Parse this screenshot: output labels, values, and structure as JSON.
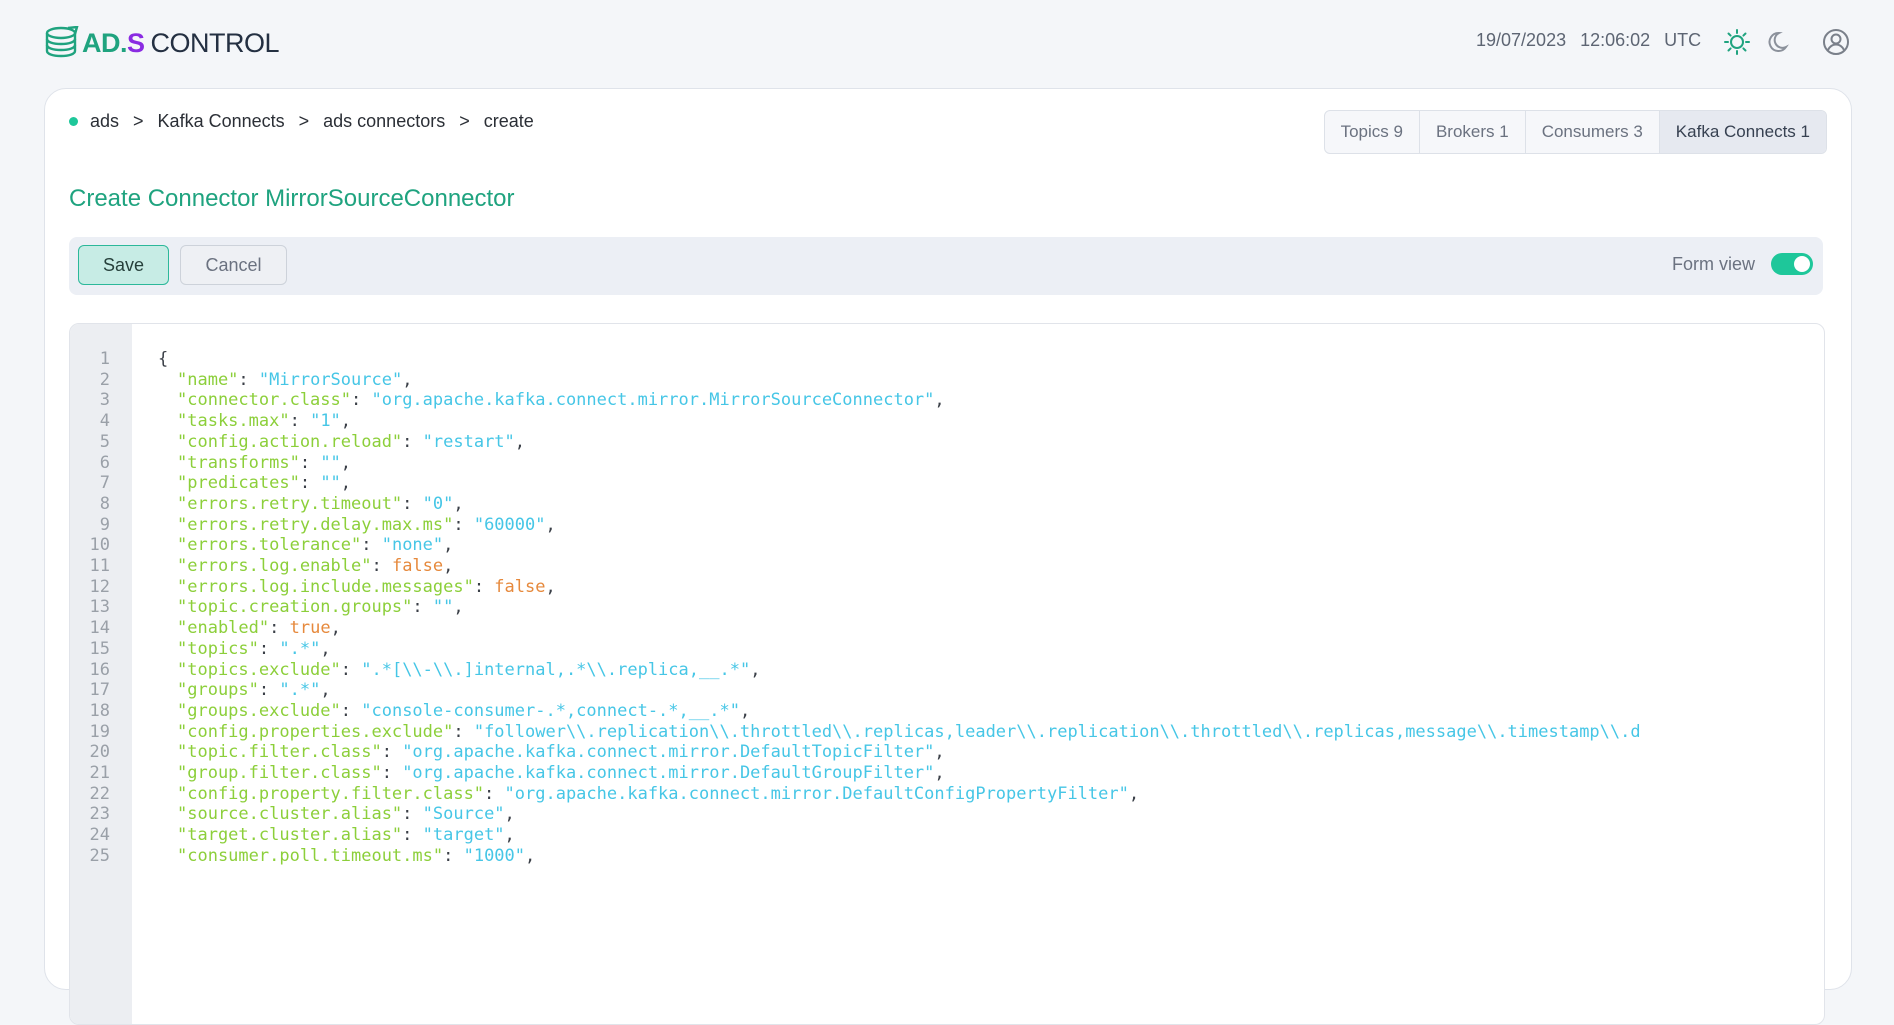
{
  "header": {
    "logo_text": "AD.S CONTROL",
    "date": "19/07/2023",
    "time": "12:06:02",
    "timezone": "UTC",
    "icons": [
      "light-theme-icon",
      "dark-theme-icon",
      "user-account-icon"
    ]
  },
  "breadcrumb": [
    {
      "label": "ads"
    },
    {
      "label": "Kafka Connects"
    },
    {
      "label": "ads connectors"
    },
    {
      "label": "create"
    }
  ],
  "tabs": [
    {
      "label": "Topics 9"
    },
    {
      "label": "Brokers 1"
    },
    {
      "label": "Consumers 3"
    },
    {
      "label": "Kafka Connects 1",
      "active": true
    }
  ],
  "page_title": "Create Connector MirrorSourceConnector",
  "toolbar": {
    "save_label": "Save",
    "cancel_label": "Cancel",
    "form_view_label": "Form view",
    "form_view_enabled": true
  },
  "colors": {
    "accent": "#1fa37f",
    "toggle_on": "#1ec79a",
    "json_key": "#8ccf3a",
    "json_string": "#46c6e6",
    "json_boolean": "#e6893c"
  },
  "editor": {
    "open_brace": "{",
    "entries": [
      {
        "key": "\"name\"",
        "value": "\"MirrorSource\"",
        "type": "string"
      },
      {
        "key": "\"connector.class\"",
        "value": "\"org.apache.kafka.connect.mirror.MirrorSourceConnector\"",
        "type": "string"
      },
      {
        "key": "\"tasks.max\"",
        "value": "\"1\"",
        "type": "string"
      },
      {
        "key": "\"config.action.reload\"",
        "value": "\"restart\"",
        "type": "string"
      },
      {
        "key": "\"transforms\"",
        "value": "\"\"",
        "type": "string"
      },
      {
        "key": "\"predicates\"",
        "value": "\"\"",
        "type": "string"
      },
      {
        "key": "\"errors.retry.timeout\"",
        "value": "\"0\"",
        "type": "string"
      },
      {
        "key": "\"errors.retry.delay.max.ms\"",
        "value": "\"60000\"",
        "type": "string"
      },
      {
        "key": "\"errors.tolerance\"",
        "value": "\"none\"",
        "type": "string"
      },
      {
        "key": "\"errors.log.enable\"",
        "value": "false",
        "type": "boolean"
      },
      {
        "key": "\"errors.log.include.messages\"",
        "value": "false",
        "type": "boolean"
      },
      {
        "key": "\"topic.creation.groups\"",
        "value": "\"\"",
        "type": "string"
      },
      {
        "key": "\"enabled\"",
        "value": "true",
        "type": "boolean"
      },
      {
        "key": "\"topics\"",
        "value": "\".*\"",
        "type": "string"
      },
      {
        "key": "\"topics.exclude\"",
        "value": "\".*[\\\\-\\\\.]internal,.*\\\\.replica,__.*\"",
        "type": "string"
      },
      {
        "key": "\"groups\"",
        "value": "\".*\"",
        "type": "string"
      },
      {
        "key": "\"groups.exclude\"",
        "value": "\"console-consumer-.*,connect-.*,__.*\"",
        "type": "string"
      },
      {
        "key": "\"config.properties.exclude\"",
        "value": "\"follower\\\\.replication\\\\.throttled\\\\.replicas,leader\\\\.replication\\\\.throttled\\\\.replicas,message\\\\.timestamp\\\\.d",
        "type": "string",
        "truncated": true
      },
      {
        "key": "\"topic.filter.class\"",
        "value": "\"org.apache.kafka.connect.mirror.DefaultTopicFilter\"",
        "type": "string"
      },
      {
        "key": "\"group.filter.class\"",
        "value": "\"org.apache.kafka.connect.mirror.DefaultGroupFilter\"",
        "type": "string"
      },
      {
        "key": "\"config.property.filter.class\"",
        "value": "\"org.apache.kafka.connect.mirror.DefaultConfigPropertyFilter\"",
        "type": "string"
      },
      {
        "key": "\"source.cluster.alias\"",
        "value": "\"Source\"",
        "type": "string"
      },
      {
        "key": "\"target.cluster.alias\"",
        "value": "\"target\"",
        "type": "string"
      },
      {
        "key": "\"consumer.poll.timeout.ms\"",
        "value": "\"1000\"",
        "type": "string"
      }
    ]
  }
}
